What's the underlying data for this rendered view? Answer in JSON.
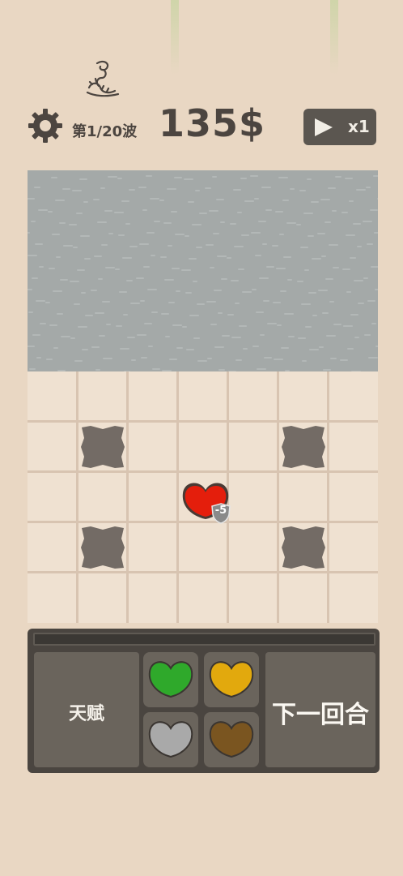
{
  "header": {
    "wave_label": "第1/20波",
    "money": "135$",
    "speed_label": "x1"
  },
  "bottom_panel": {
    "talent_label": "天赋",
    "next_round_label": "下一回合",
    "wave_progress": 0,
    "seed_slots": [
      {
        "name": "green-heart-seed",
        "color": "#2fa92b"
      },
      {
        "name": "yellow-heart-seed",
        "color": "#e2a90d"
      },
      {
        "name": "gray-heart-seed",
        "color": "#a9a9a9"
      },
      {
        "name": "brown-heart-seed",
        "color": "#7a5520"
      }
    ]
  },
  "board": {
    "unit": {
      "color": "#e41e0c",
      "shield_value": "-5"
    }
  },
  "icons": {
    "settings": "gear-icon",
    "worm": "worm-icon",
    "speed": "play-icon"
  }
}
